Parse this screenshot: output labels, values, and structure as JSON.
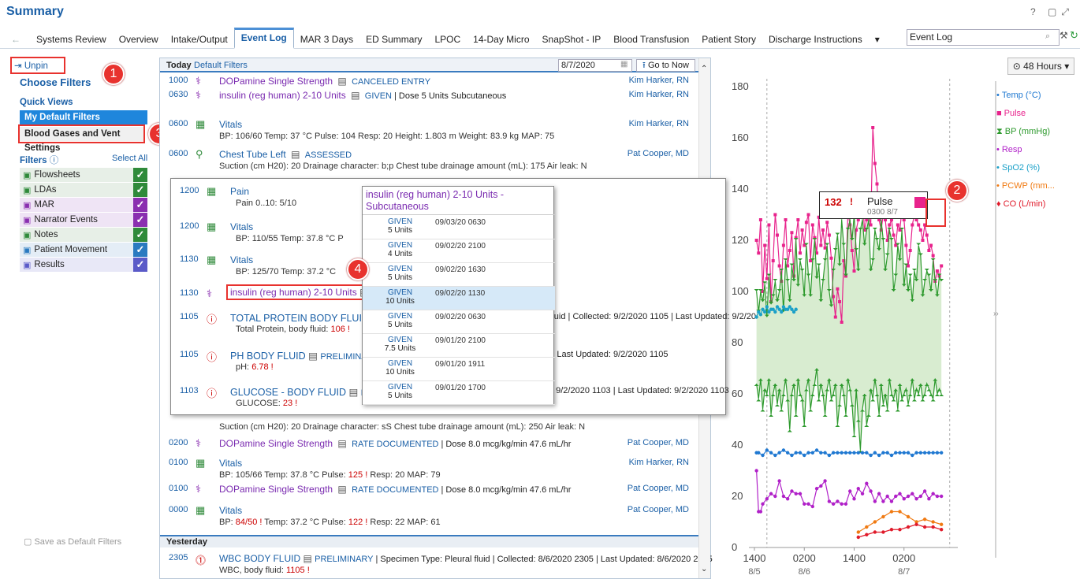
{
  "app": {
    "title": "Summary"
  },
  "tabs": [
    "Systems Review",
    "Overview",
    "Intake/Output",
    "Event Log",
    "MAR 3 Days",
    "ED Summary",
    "LPOC",
    "14-Day Micro",
    "SnapShot - IP",
    "Blood Transfusion",
    "Patient Story",
    "Discharge Instructions"
  ],
  "active_tab": "Event Log",
  "tab_search_value": "Event Log",
  "left": {
    "unpin": "Unpin",
    "choose": "Choose Filters",
    "quick_views": "Quick Views",
    "qv1": "My Default Filters",
    "qv2": "Blood Gases and Vent Settings",
    "filters": "Filters",
    "select_all": "Select All",
    "filter_items": [
      {
        "label": "Flowsheets",
        "color": "#2f8a3a",
        "bg": "#e7efe7"
      },
      {
        "label": "LDAs",
        "color": "#2f8a3a",
        "bg": "#e7efe7"
      },
      {
        "label": "MAR",
        "color": "#8a2fb0",
        "bg": "#efe4f5"
      },
      {
        "label": "Narrator Events",
        "color": "#8a2fb0",
        "bg": "#efe4f5"
      },
      {
        "label": "Notes",
        "color": "#2f8a3a",
        "bg": "#e7efe7"
      },
      {
        "label": "Patient Movement",
        "color": "#2a7ac0",
        "bg": "#e4edf6"
      },
      {
        "label": "Results",
        "color": "#5a5ac8",
        "bg": "#e8e8f7"
      }
    ],
    "save_default": "Save as Default Filters"
  },
  "callouts": [
    "1",
    "2",
    "3",
    "4"
  ],
  "log": {
    "today": "Today",
    "default_filters": "Default Filters",
    "date": "8/7/2020",
    "goto": "Go to Now",
    "rows": [
      {
        "time": "1000",
        "title": "DOPamine Single Strength",
        "status": "CANCELED ENTRY",
        "detail": "",
        "by": "Kim Harker, RN"
      },
      {
        "time": "0630",
        "title": "insulin (reg human) 2-10 Units",
        "status": "GIVEN",
        "detail": "| Dose 5 Units Subcutaneous",
        "by": "Kim Harker, RN"
      },
      {
        "time": "0600",
        "title": "Vitals",
        "sub": "BP: 106/60   Temp: 37 °C   Pulse: 104   Resp: 20   Height: 1.803 m   Weight: 83.9 kg   MAP: 75",
        "by": "Kim Harker, RN"
      },
      {
        "time": "0600",
        "title": "Chest Tube Left",
        "status": "ASSESSED",
        "sub": "Suction (cm H20): 20   Drainage character: b;p   Chest tube drainage amount (mL): 175   Air leak: N",
        "by": "Pat Cooper, MD"
      },
      {
        "sub": "Suction (cm H20): 20   Drainage character: sS   Chest tube drainage amount (mL): 250   Air leak: N"
      },
      {
        "time": "0200",
        "title": "DOPamine Single Strength",
        "status": "RATE DOCUMENTED",
        "detail": "| Dose 8.0 mcg/kg/min 47.6 mL/hr",
        "by": "Pat Cooper, MD"
      },
      {
        "time": "0100",
        "title": "Vitals",
        "sub1": "BP: 105/66   Temp: 37.8 °C   Pulse: ",
        "sub_red": "125",
        "sub2": "   Resp: 20   MAP: 79",
        "by": "Kim Harker, RN"
      },
      {
        "time": "0100",
        "title": "DOPamine Single Strength",
        "status": "RATE DOCUMENTED",
        "detail": "| Dose 8.0 mcg/kg/min 47.6 mL/hr",
        "by": "Pat Cooper, MD"
      },
      {
        "time": "0000",
        "title": "Vitals",
        "sub1": "BP: ",
        "sub_red": "84/50",
        "sub2": "   Temp: 37.2 °C   Pulse: ",
        "sub_red2": "122",
        "sub3": "   Resp: 22   MAP: 61",
        "by": "Pat Cooper, MD"
      }
    ],
    "yesterday": "Yesterday",
    "yrow": {
      "time": "2305",
      "title": "WBC BODY FLUID",
      "status": "PRELIMINARY",
      "detail": "| Specimen Type: Pleural fluid | Collected: 8/6/2020 2305 | Last Updated: 8/6/2020 2305",
      "sub": "WBC, body fluid: ",
      "val": "1105"
    }
  },
  "overlay": {
    "rows": [
      {
        "time": "1200",
        "title": "Pain",
        "sub": "Pain 0..10: 5/10"
      },
      {
        "time": "1200",
        "title": "Vitals",
        "sub": "BP: 110/55   Temp: 37.8 °C   P"
      },
      {
        "time": "1130",
        "title": "Vitals",
        "sub": "BP: 125/70   Temp: 37.2 °C"
      },
      {
        "time": "1130",
        "title": "insulin (reg human) 2-10 Units",
        "tail": "us"
      },
      {
        "time": "1105",
        "title": "TOTAL PROTEIN BODY FLUID",
        "tail": "Pleural fluid | Collected: 9/2/2020 1105 | Last Updated: 9/2/2020 1105",
        "sub": "Total Protein, body fluid: ",
        "val": "106"
      },
      {
        "time": "1105",
        "title": "PH BODY FLUID",
        "status": "PRELIMINARY",
        "tail": "cted: 9/2/2020 1105 | Last Updated: 9/2/2020 1105",
        "sub": "pH: ",
        "val": "6.78"
      },
      {
        "time": "1103",
        "title": "GLUCOSE - BODY FLUID",
        "status": "PRE",
        "tail": "fluid | Collected: 9/2/2020 1103 | Last Updated: 9/2/2020 1103",
        "sub": "GLUCOSE: ",
        "val": "23"
      }
    ]
  },
  "popup": {
    "title": "insulin (reg human) 2-10 Units - Subcutaneous",
    "entries": [
      {
        "status": "GIVEN",
        "dose": "5 Units",
        "date": "09/03/20 0630"
      },
      {
        "status": "GIVEN",
        "dose": "4 Units",
        "date": "09/02/20 2100"
      },
      {
        "status": "GIVEN",
        "dose": "5 Units",
        "date": "09/02/20 1630"
      },
      {
        "status": "GIVEN",
        "dose": "10 Units",
        "date": "09/02/20 1130"
      },
      {
        "status": "GIVEN",
        "dose": "5 Units",
        "date": "09/02/20 0630"
      },
      {
        "status": "GIVEN",
        "dose": "7.5 Units",
        "date": "09/01/20 2100"
      },
      {
        "status": "GIVEN",
        "dose": "10 Units",
        "date": "09/01/20 1911"
      },
      {
        "status": "GIVEN",
        "dose": "5 Units",
        "date": "09/01/20 1700"
      }
    ]
  },
  "tooltip": {
    "value": "132",
    "label": "Pulse",
    "time": "0300 8/7"
  },
  "chart_controls": {
    "range": "48 Hours"
  },
  "chart_data": {
    "type": "line",
    "yticks": [
      0,
      20,
      40,
      60,
      80,
      100,
      120,
      140,
      160,
      180
    ],
    "ylim": [
      0,
      180
    ],
    "xticks": [
      {
        "t": "1400",
        "d": "8/5"
      },
      {
        "t": "0200",
        "d": "8/6"
      },
      {
        "t": "1400",
        "d": ""
      },
      {
        "t": "0200",
        "d": "8/7"
      }
    ],
    "xlim": [
      0,
      48
    ],
    "legend": [
      {
        "name": "Temp (°C)",
        "color": "#1f78d1",
        "marker": "•"
      },
      {
        "name": "Pulse",
        "color": "#e8238c",
        "marker": "■"
      },
      {
        "name": "BP (mmHg)",
        "color": "#2e9a2e",
        "marker": "⧗"
      },
      {
        "name": "Resp",
        "color": "#b020c8",
        "marker": "•"
      },
      {
        "name": "SpO2 (%)",
        "color": "#1aa0c8",
        "marker": "•"
      },
      {
        "name": "PCWP (mm...",
        "color": "#f07a12",
        "marker": "•"
      },
      {
        "name": "CO (L/min)",
        "color": "#e01a2a",
        "marker": "♦"
      }
    ],
    "series": [
      {
        "name": "Pulse",
        "color": "#e8238c",
        "x": [
          0.5,
          1,
          1.5,
          2,
          2.5,
          3,
          3.5,
          4,
          4.5,
          5,
          5.5,
          6,
          6.5,
          7,
          7.5,
          8,
          8.5,
          9,
          9.5,
          10,
          10.5,
          11,
          11.5,
          12,
          12.5,
          13,
          13.5,
          14,
          14.5,
          15,
          15.5,
          16,
          16.5,
          17,
          17.5,
          18,
          18.5,
          19,
          19.5,
          20,
          20.5,
          21,
          21.5,
          22,
          22.5,
          23,
          23.5,
          24,
          24.5,
          25,
          25.5,
          26,
          26.5,
          27,
          27.5,
          28,
          28.5,
          29,
          29.5,
          30,
          30.5,
          31,
          31.5,
          32,
          32.5,
          33,
          33.5,
          34,
          34.5,
          35,
          35.5,
          36,
          36.5,
          37,
          37.5,
          38,
          38.5,
          39,
          39.5,
          40,
          40.5,
          41,
          41.5,
          42,
          42.5,
          43,
          43.5,
          44,
          44.5,
          45
        ],
        "y": [
          120,
          115,
          128,
          100,
          118,
          105,
          126,
          96,
          112,
          130,
          122,
          110,
          104,
          118,
          128,
          110,
          116,
          123,
          106,
          121,
          128,
          115,
          124,
          118,
          127,
          130,
          112,
          126,
          121,
          115,
          129,
          118,
          124,
          117,
          127,
          122,
          113,
          98,
          90,
          101,
          96,
          88,
          112,
          106,
          131,
          126,
          116,
          108,
          124,
          128,
          132,
          136,
          124,
          128,
          130,
          126,
          164,
          150,
          142,
          128,
          124,
          130,
          128,
          120,
          126,
          128,
          122,
          118,
          126,
          124,
          132,
          128,
          118,
          110,
          116,
          126,
          130,
          128,
          126,
          124,
          120,
          126,
          122,
          116,
          118,
          114,
          104,
          108,
          106,
          110
        ]
      },
      {
        "name": "BP sys",
        "color": "#2e9a2e",
        "x": [
          0.5,
          1,
          1.5,
          2,
          2.5,
          3,
          3.5,
          4,
          4.5,
          5,
          5.5,
          6,
          6.5,
          7,
          7.5,
          8,
          8.5,
          9,
          9.5,
          10,
          10.5,
          11,
          11.5,
          12,
          12.5,
          13,
          13.5,
          14,
          14.5,
          15,
          15.5,
          16,
          16.5,
          17,
          17.5,
          18,
          18.5,
          19,
          19.5,
          20,
          20.5,
          21,
          21.5,
          22,
          22.5,
          23,
          23.5,
          24,
          24.5,
          25,
          25.5,
          26,
          26.5,
          27,
          27.5,
          28,
          28.5,
          29,
          29.5,
          30,
          30.5,
          31,
          31.5,
          32,
          32.5,
          33,
          33.5,
          34,
          34.5,
          35,
          35.5,
          36,
          36.5,
          37,
          37.5,
          38,
          38.5,
          39,
          39.5,
          40,
          40.5,
          41,
          41.5,
          42,
          42.5,
          43,
          43.5,
          44,
          44.5,
          45
        ],
        "y": [
          100,
          92,
          100,
          96,
          103,
          90,
          106,
          95,
          98,
          104,
          96,
          100,
          108,
          92,
          112,
          104,
          96,
          110,
          104,
          120,
          102,
          112,
          108,
          98,
          118,
          106,
          98,
          112,
          120,
          105,
          110,
          96,
          104,
          112,
          118,
          100,
          94,
          108,
          116,
          122,
          110,
          128,
          118,
          106,
          124,
          128,
          120,
          130,
          116,
          108,
          124,
          128,
          118,
          124,
          128,
          108,
          112,
          124,
          120,
          116,
          128,
          120,
          108,
          114,
          124,
          120,
          100,
          106,
          118,
          112,
          124,
          102,
          110,
          100,
          106,
          96,
          108,
          104,
          118,
          114,
          98,
          104,
          108,
          106,
          100,
          112,
          104,
          98,
          106,
          104
        ]
      },
      {
        "name": "BP dia",
        "color": "#2e9a2e",
        "x": [
          0.5,
          1,
          1.5,
          2,
          2.5,
          3,
          3.5,
          4,
          4.5,
          5,
          5.5,
          6,
          6.5,
          7,
          7.5,
          8,
          8.5,
          9,
          9.5,
          10,
          10.5,
          11,
          11.5,
          12,
          12.5,
          13,
          13.5,
          14,
          14.5,
          15,
          15.5,
          16,
          16.5,
          17,
          17.5,
          18,
          18.5,
          19,
          19.5,
          20,
          20.5,
          21,
          21.5,
          22,
          22.5,
          23,
          23.5,
          24,
          24.5,
          25,
          25.5,
          26,
          26.5,
          27,
          27.5,
          28,
          28.5,
          29,
          29.5,
          30,
          30.5,
          31,
          31.5,
          32,
          32.5,
          33,
          33.5,
          34,
          34.5,
          35,
          35.5,
          36,
          36.5,
          37,
          37.5,
          38,
          38.5,
          39,
          39.5,
          40,
          40.5,
          41,
          41.5,
          42,
          42.5,
          43,
          43.5,
          44,
          44.5,
          45
        ],
        "y": [
          64,
          58,
          66,
          54,
          62,
          60,
          66,
          52,
          60,
          64,
          56,
          62,
          54,
          60,
          66,
          58,
          46,
          60,
          64,
          52,
          66,
          60,
          58,
          48,
          62,
          66,
          54,
          60,
          64,
          70,
          58,
          64,
          60,
          52,
          62,
          66,
          58,
          60,
          64,
          48,
          56,
          64,
          60,
          52,
          66,
          62,
          56,
          44,
          62,
          50,
          38,
          54,
          60,
          48,
          52,
          62,
          58,
          66,
          60,
          52,
          64,
          56,
          60,
          54,
          66,
          60,
          58,
          62,
          54,
          64,
          58,
          60,
          62,
          56,
          60,
          66,
          58,
          62,
          60,
          64,
          58,
          60,
          64,
          62,
          60,
          58,
          66,
          60,
          62,
          60
        ]
      },
      {
        "name": "Temp",
        "color": "#1f78d1",
        "x": [
          0.5,
          1,
          2,
          3,
          4,
          5,
          6,
          7,
          8,
          9,
          10,
          11,
          12,
          13,
          14,
          15,
          16,
          17,
          18,
          19,
          20,
          21,
          22,
          23,
          24,
          25,
          26,
          27,
          28,
          29,
          30,
          31,
          32,
          33,
          34,
          35,
          36,
          37,
          38,
          39,
          40,
          41,
          42,
          43,
          44,
          45
        ],
        "y": [
          37,
          37,
          36,
          38,
          37,
          36,
          37,
          38,
          37,
          36,
          37,
          37,
          36,
          37,
          37,
          38,
          37,
          37,
          36,
          37,
          37,
          37,
          37,
          37,
          37,
          37,
          37,
          37,
          36,
          37,
          36,
          37,
          37,
          36,
          37,
          37,
          37,
          37,
          36,
          37,
          37,
          37,
          37,
          37,
          37,
          37
        ]
      },
      {
        "name": "Resp",
        "color": "#b020c8",
        "x": [
          0.5,
          1,
          1.5,
          2,
          3,
          4,
          5,
          6,
          7,
          8,
          9,
          10,
          11,
          12,
          13,
          14,
          15,
          16,
          17,
          18,
          19,
          20,
          21,
          22,
          23,
          24,
          25,
          26,
          27,
          28,
          29,
          30,
          31,
          32,
          33,
          34,
          35,
          36,
          37,
          38,
          39,
          40,
          41,
          42,
          43,
          44,
          45
        ],
        "y": [
          30,
          14,
          14,
          17,
          19,
          21,
          20,
          26,
          20,
          19,
          22,
          21,
          21,
          17,
          17,
          16,
          23,
          24,
          26,
          18,
          17,
          18,
          17,
          17,
          22,
          19,
          23,
          21,
          25,
          22,
          18,
          21,
          18,
          20,
          18,
          20,
          21,
          19,
          20,
          21,
          19,
          20,
          22,
          19,
          21,
          20,
          20
        ]
      },
      {
        "name": "SpO2",
        "color": "#1aa0c8",
        "x": [
          0.5,
          1,
          1.5,
          2,
          2.5,
          3,
          3.5,
          4,
          4.5,
          5,
          5.5,
          6,
          6.5,
          7,
          7.5,
          8,
          8.5,
          9,
          9.5,
          10
        ],
        "y": [
          90,
          92,
          91,
          93,
          92,
          94,
          92,
          93,
          93,
          92,
          94,
          93,
          92,
          94,
          93,
          93,
          94,
          93,
          92,
          93
        ]
      },
      {
        "name": "PCWP",
        "color": "#f07a12",
        "x": [
          25,
          27,
          29,
          31,
          33,
          35,
          37,
          39,
          41,
          43,
          45
        ],
        "y": [
          6,
          8,
          10,
          12,
          14,
          14,
          12,
          10,
          11,
          10,
          9
        ]
      },
      {
        "name": "CO",
        "color": "#e01a2a",
        "x": [
          25,
          27,
          29,
          31,
          33,
          35,
          37,
          39,
          41,
          43,
          45
        ],
        "y": [
          4,
          5,
          6,
          6,
          7,
          7,
          8,
          9,
          8,
          8,
          7
        ]
      }
    ]
  }
}
